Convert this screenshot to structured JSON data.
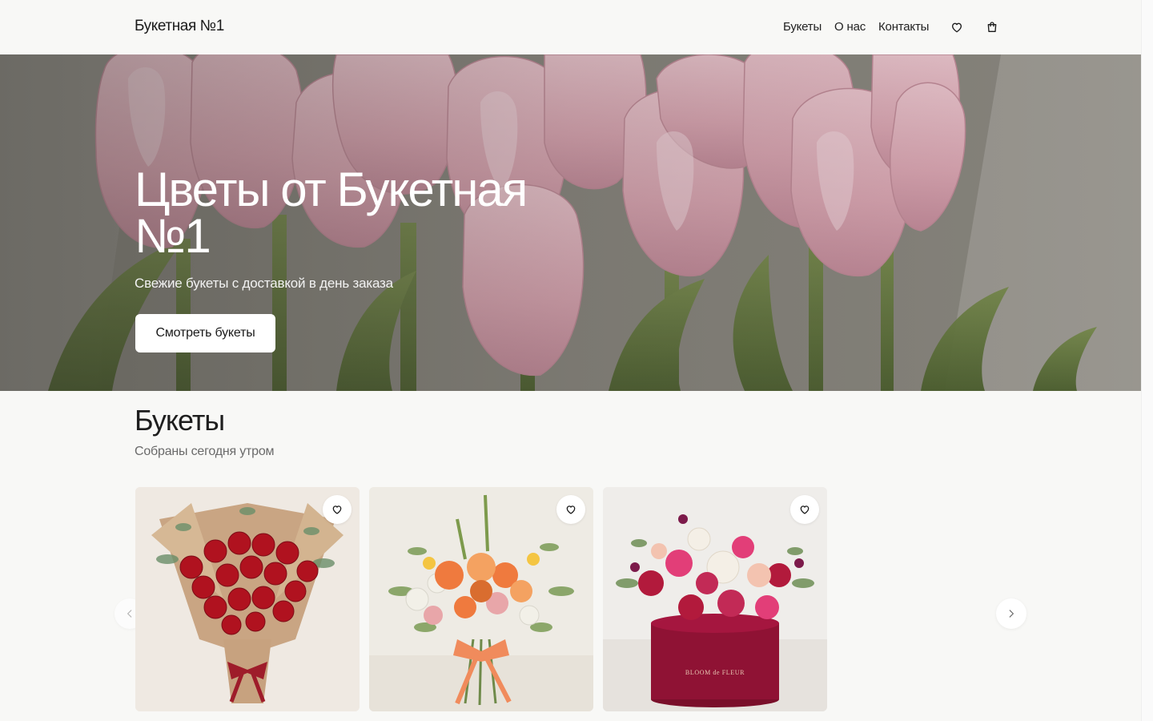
{
  "header": {
    "logo": "Букетная №1",
    "nav": [
      "Букеты",
      "О нас",
      "Контакты"
    ],
    "icons": [
      "heart-icon",
      "shopping-bag-icon"
    ]
  },
  "hero": {
    "title": "Цветы от Букетная №1",
    "subtitle": "Свежие букеты с доставкой в день заказа",
    "cta_label": "Смотреть букеты"
  },
  "catalog": {
    "title": "Букеты",
    "subtitle": "Собраны сегодня утром",
    "cards": [
      {
        "image": "red-roses-bouquet-kraft",
        "favorite_icon": "heart-icon"
      },
      {
        "image": "orange-mixed-bouquet-ribbon",
        "favorite_icon": "heart-icon"
      },
      {
        "image": "pink-roses-hatbox",
        "favorite_icon": "heart-icon",
        "box_text": "BLOOM de FLEUR"
      }
    ],
    "prev_icon": "chevron-left-icon",
    "next_icon": "chevron-right-icon"
  },
  "colors": {
    "background": "#f8f8f6",
    "button_bg": "#ffffff",
    "text": "#1f1f1f",
    "muted_text": "#6a6a6a",
    "tulip_pink": "#e8b8c3"
  }
}
